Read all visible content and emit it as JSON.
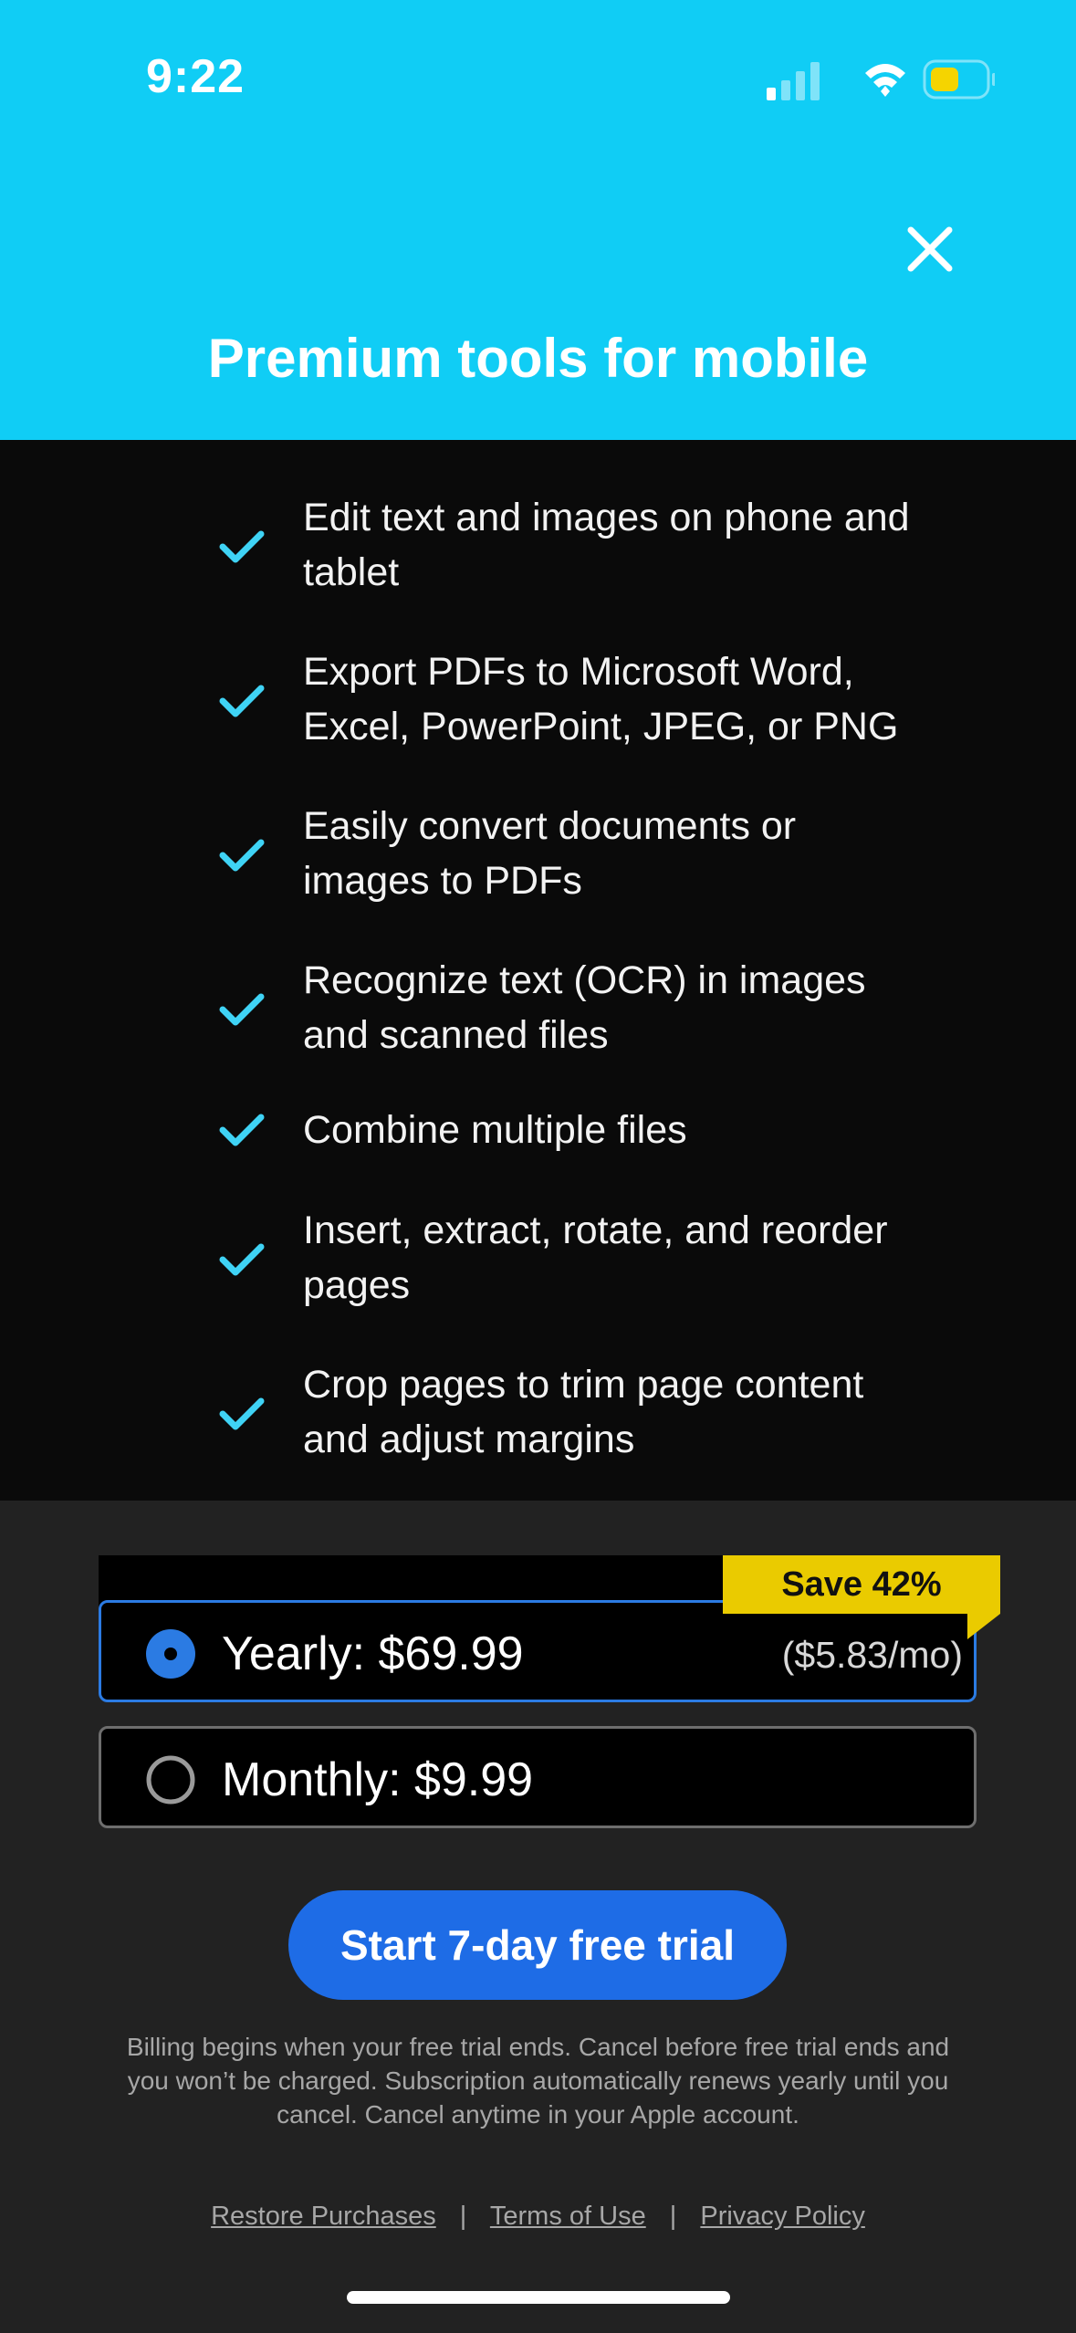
{
  "status_bar": {
    "time": "9:22"
  },
  "header": {
    "title": "Premium tools for mobile",
    "close_icon": "close-icon",
    "background": "#10CDF5"
  },
  "features": {
    "check_icon": "checkmark-icon",
    "check_color": "#3FD3F5",
    "items": [
      "Edit text and images on phone and tablet",
      "Export PDFs to Microsoft Word, Excel, PowerPoint, JPEG, or PNG",
      "Easily convert documents or images to PDFs",
      "Recognize text (OCR) in images and scanned files",
      "Combine multiple files",
      "Insert, extract, rotate, and reorder pages",
      "Crop pages to trim page content and adjust margins"
    ]
  },
  "plans": {
    "badge": "Save 42%",
    "badge_color": "#EACB00",
    "selected_color": "#2B7BE3",
    "yearly": {
      "label": "Yearly: $69.99",
      "per_month": "($5.83/mo)",
      "selected": true
    },
    "monthly": {
      "label": "Monthly: $9.99",
      "selected": false
    }
  },
  "cta": {
    "label": "Start 7-day free trial",
    "color": "#1E6CE6"
  },
  "disclaimer": "Billing begins when your free trial ends. Cancel before free trial ends and you won’t be charged. Subscription automatically renews yearly until you cancel. Cancel anytime in your Apple account.",
  "footer_links": {
    "restore": "Restore Purchases",
    "terms": "Terms of Use",
    "privacy": "Privacy Policy",
    "separator": "|"
  }
}
